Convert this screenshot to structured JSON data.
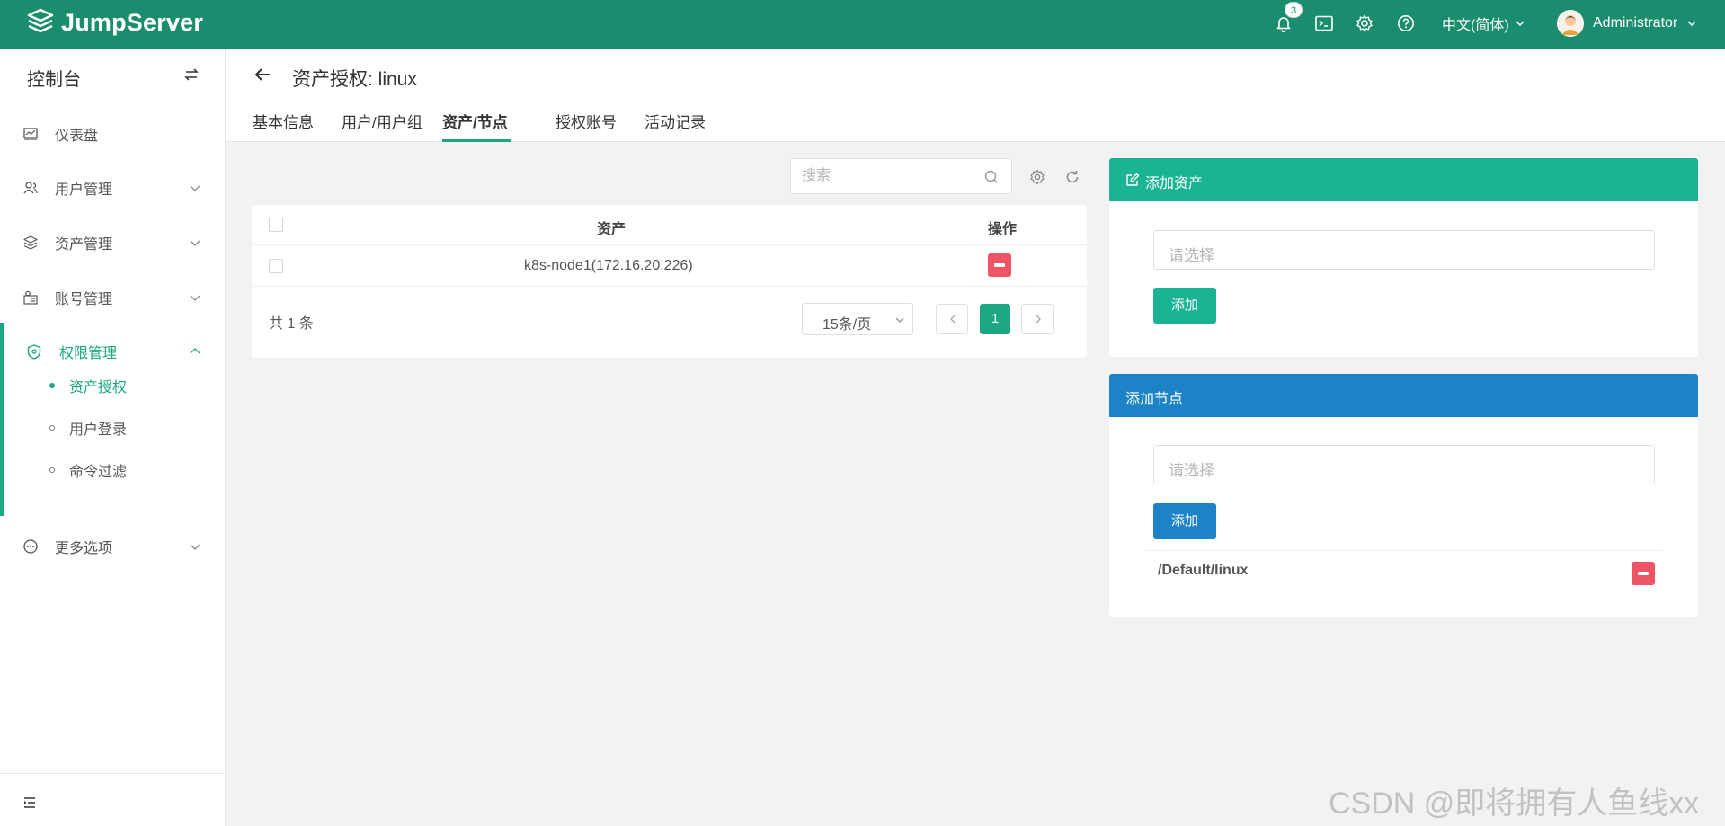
{
  "app": {
    "logo_text": "JumpServer"
  },
  "topbar": {
    "notification_count": "3",
    "language": "中文(简体)",
    "username": "Administrator"
  },
  "sidebar": {
    "title": "控制台",
    "items": [
      {
        "label": "仪表盘",
        "icon": "dashboard-icon"
      },
      {
        "label": "用户管理",
        "icon": "users-icon"
      },
      {
        "label": "资产管理",
        "icon": "assets-icon"
      },
      {
        "label": "账号管理",
        "icon": "accounts-icon"
      },
      {
        "label": "权限管理",
        "icon": "permission-shield-icon"
      },
      {
        "label": "更多选项",
        "icon": "more-options-icon"
      }
    ],
    "sub_items": [
      {
        "label": "资产授权"
      },
      {
        "label": "用户登录"
      },
      {
        "label": "命令过滤"
      }
    ]
  },
  "page": {
    "title": "资产授权: linux",
    "tabs": [
      {
        "label": "基本信息"
      },
      {
        "label": "用户/用户组"
      },
      {
        "label": "资产/节点"
      },
      {
        "label": "授权账号"
      },
      {
        "label": "活动记录"
      }
    ],
    "active_tab": "资产/节点"
  },
  "table": {
    "search_placeholder": "搜索",
    "columns": [
      "资产",
      "操作"
    ],
    "rows": [
      {
        "asset": "k8s-node1(172.16.20.226)"
      }
    ],
    "total_text": "共 1 条",
    "page_size": "15条/页",
    "current_page": "1"
  },
  "add_asset_panel": {
    "title": "添加资产",
    "placeholder": "请选择",
    "button": "添加"
  },
  "add_node_panel": {
    "title": "添加节点",
    "placeholder": "请选择",
    "button": "添加",
    "nodes": [
      "/Default/linux"
    ]
  },
  "watermark": "CSDN @即将拥有人鱼线xx",
  "colors": {
    "topbar": "#1b8d6f",
    "accent": "#1aa781",
    "asset_panel_header": "#1ab394",
    "node_panel_header": "#1c84c6",
    "danger": "#ed5565"
  }
}
